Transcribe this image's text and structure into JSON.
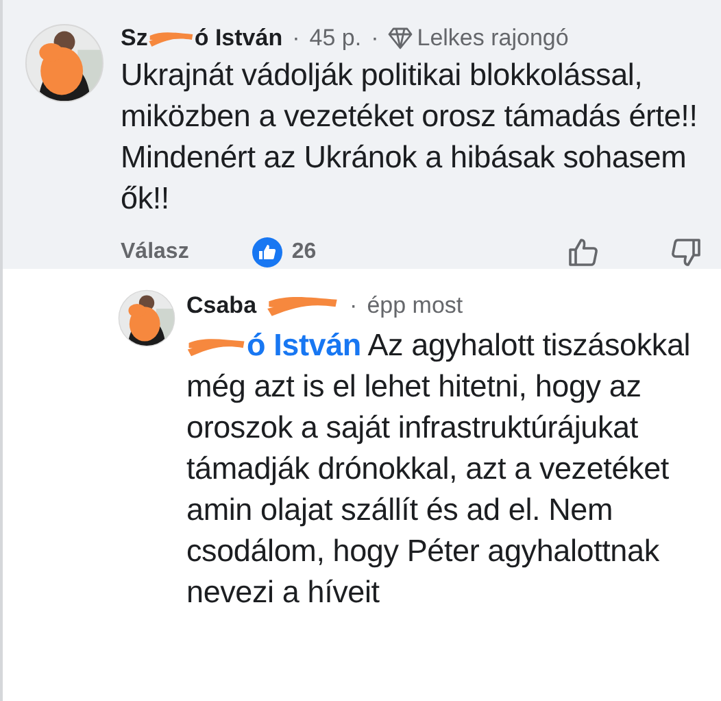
{
  "comment": {
    "author_start": "Sz",
    "author_end": "ó István",
    "dot": "·",
    "time": "45 p.",
    "badge": "Lelkes rajongó",
    "text": "Ukrajnát vádolják politikai blokkolással, miközben a vezetéket orosz támadás érte!! Mindenért az Ukránok a hibásak sohasem ők!!",
    "reply_label": "Válasz",
    "reaction_count": "26"
  },
  "reply": {
    "author": "Csaba",
    "dot": "·",
    "time": "épp most",
    "mention": "ó István",
    "text": "Az agyhalott tiszásokkal még azt is el lehet hitetni, hogy az oroszok a saját infrastruktúrájukat támadják drónokkal, azt a vezetéket amin olajat szállít és ad el. Nem csodálom, hogy Péter agyhalottnak nevezi a híveit"
  }
}
